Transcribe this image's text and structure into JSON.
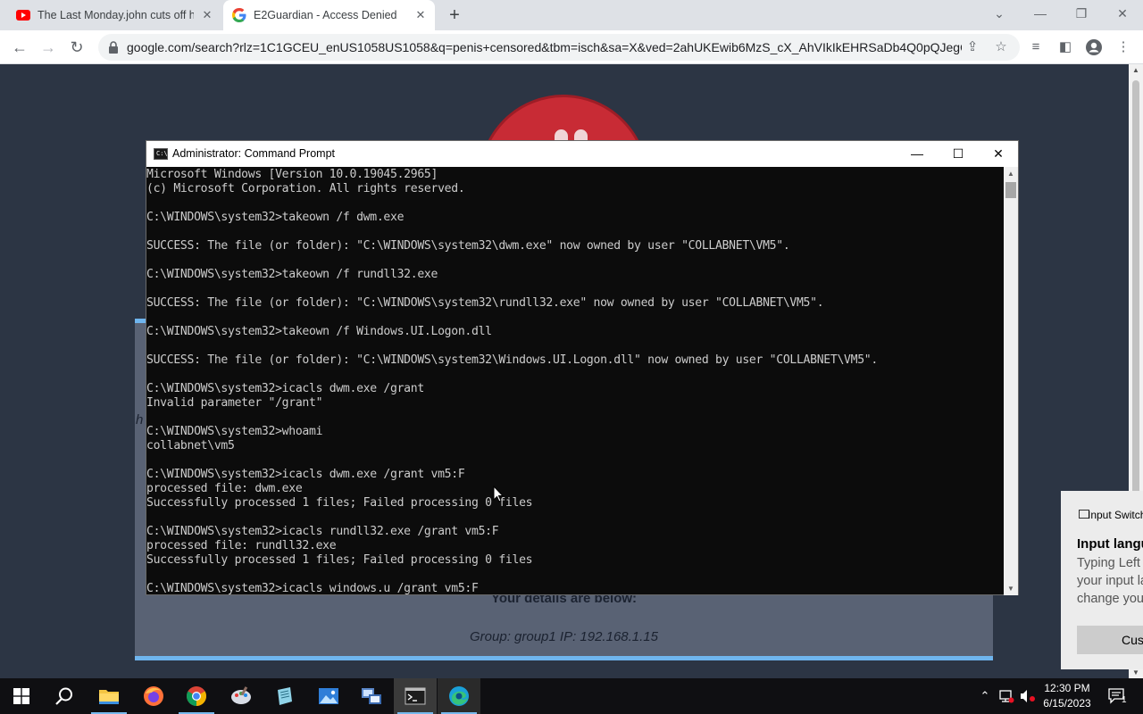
{
  "browser": {
    "tabs": [
      {
        "title": "The Last Monday.john cuts off his",
        "icon": "youtube-icon",
        "active": false
      },
      {
        "title": "E2Guardian - Access Denied",
        "icon": "google-icon",
        "active": true
      }
    ],
    "url": "google.com/search?rlz=1C1GCEU_enUS1058US1058&q=penis+censored&tbm=isch&sa=X&ved=2ahUKEwib6MzS_cX_AhVIkIkEHRSaDb4Q0pQJegQ...",
    "new_tab_glyph": "+",
    "close_glyph": "✕"
  },
  "page": {
    "details_heading": "Your details are below:",
    "group_line": "Group: group1   IP: 192.168.1.15",
    "stray_text": "h",
    "colors": {
      "background": "#2c3544",
      "badge": "#c82b35",
      "card": "#596274",
      "accent": "#6fb5ee"
    }
  },
  "cmd": {
    "title": "Administrator:  Command Prompt",
    "minimize_glyph": "—",
    "maximize_glyph": "☐",
    "close_glyph": "✕",
    "lines": [
      "Microsoft Windows [Version 10.0.19045.2965]",
      "(c) Microsoft Corporation. All rights reserved.",
      "",
      "C:\\WINDOWS\\system32>takeown /f dwm.exe",
      "",
      "SUCCESS: The file (or folder): \"C:\\WINDOWS\\system32\\dwm.exe\" now owned by user \"COLLABNET\\VM5\".",
      "",
      "C:\\WINDOWS\\system32>takeown /f rundll32.exe",
      "",
      "SUCCESS: The file (or folder): \"C:\\WINDOWS\\system32\\rundll32.exe\" now owned by user \"COLLABNET\\VM5\".",
      "",
      "C:\\WINDOWS\\system32>takeown /f Windows.UI.Logon.dll",
      "",
      "SUCCESS: The file (or folder): \"C:\\WINDOWS\\system32\\Windows.UI.Logon.dll\" now owned by user \"COLLABNET\\VM5\".",
      "",
      "C:\\WINDOWS\\system32>icacls dwm.exe /grant",
      "Invalid parameter \"/grant\"",
      "",
      "C:\\WINDOWS\\system32>whoami",
      "collabnet\\vm5",
      "",
      "C:\\WINDOWS\\system32>icacls dwm.exe /grant vm5:F",
      "processed file: dwm.exe",
      "Successfully processed 1 files; Failed processing 0 files",
      "",
      "C:\\WINDOWS\\system32>icacls rundll32.exe /grant vm5:F",
      "processed file: rundll32.exe",
      "Successfully processed 1 files; Failed processing 0 files",
      "",
      "C:\\WINDOWS\\system32>icacls windows.u /grant vm5:F"
    ]
  },
  "toast": {
    "header": "Input Switch",
    "title": "Input language",
    "body": "Typing Left Alt+Shift switches your input language. You can change your hot keys",
    "button": "Customize"
  },
  "taskbar": {
    "apps": [
      "start-button",
      "search-icon",
      "file-explorer-icon",
      "firefox-icon",
      "chrome-icon",
      "paint-icon",
      "notepad-icon",
      "photos-icon",
      "network-app-icon",
      "command-prompt-icon",
      "edge-icon"
    ],
    "time": "12:30 PM",
    "date": "6/15/2023",
    "notification_count": "1"
  }
}
